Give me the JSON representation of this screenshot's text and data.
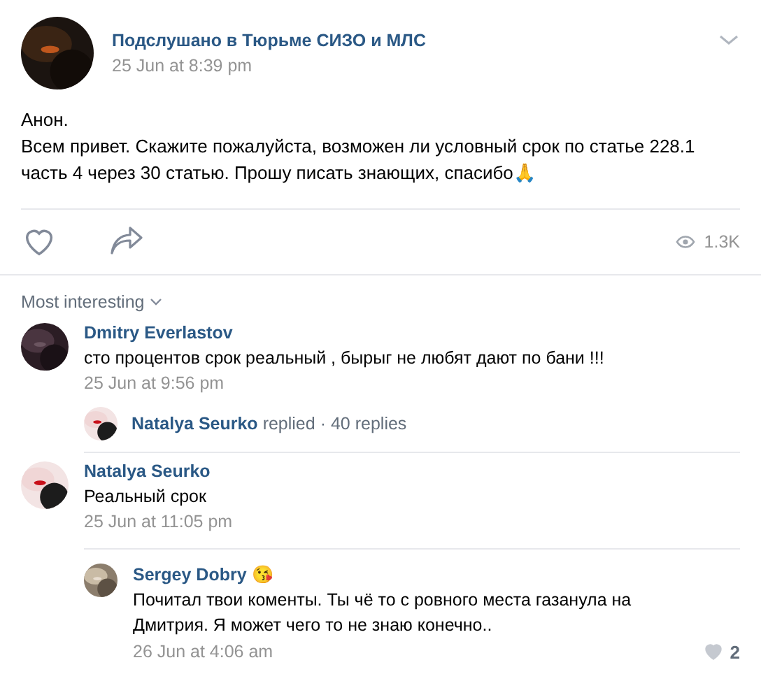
{
  "post": {
    "author": "Подслушано в Тюрьме СИЗО и МЛС",
    "date": "25 Jun at 8:39 pm",
    "lines": [
      "Анон.",
      "Всем привет. Скажите пожалуйста, возможен ли условный срок по статье 228.1 часть 4 через 30 статью. Прошу писать знающих, спасибо🙏"
    ],
    "views": "1.3K"
  },
  "sort": {
    "label": "Most interesting"
  },
  "comments": [
    {
      "author": "Dmitry Everlastov",
      "text": "сто процентов срок реальный , бырыг не любят дают по бани !!!",
      "date": "25 Jun at 9:56 pm",
      "summary": {
        "author": "Natalya Seurko",
        "action": "replied",
        "separator": "·",
        "count": "40 replies"
      }
    },
    {
      "author": "Natalya Seurko",
      "text": "Реальный срок",
      "date": "25 Jun at 11:05 pm",
      "children": [
        {
          "author": "Sergey Dobry",
          "emoji": "😘",
          "text": "Почитал твои коменты. Ты чё то с ровного места газанула на Дмитрия. Я может чего то не знаю конечно..",
          "date": "26 Jun at 4:06 am",
          "likes": "2"
        }
      ]
    }
  ]
}
